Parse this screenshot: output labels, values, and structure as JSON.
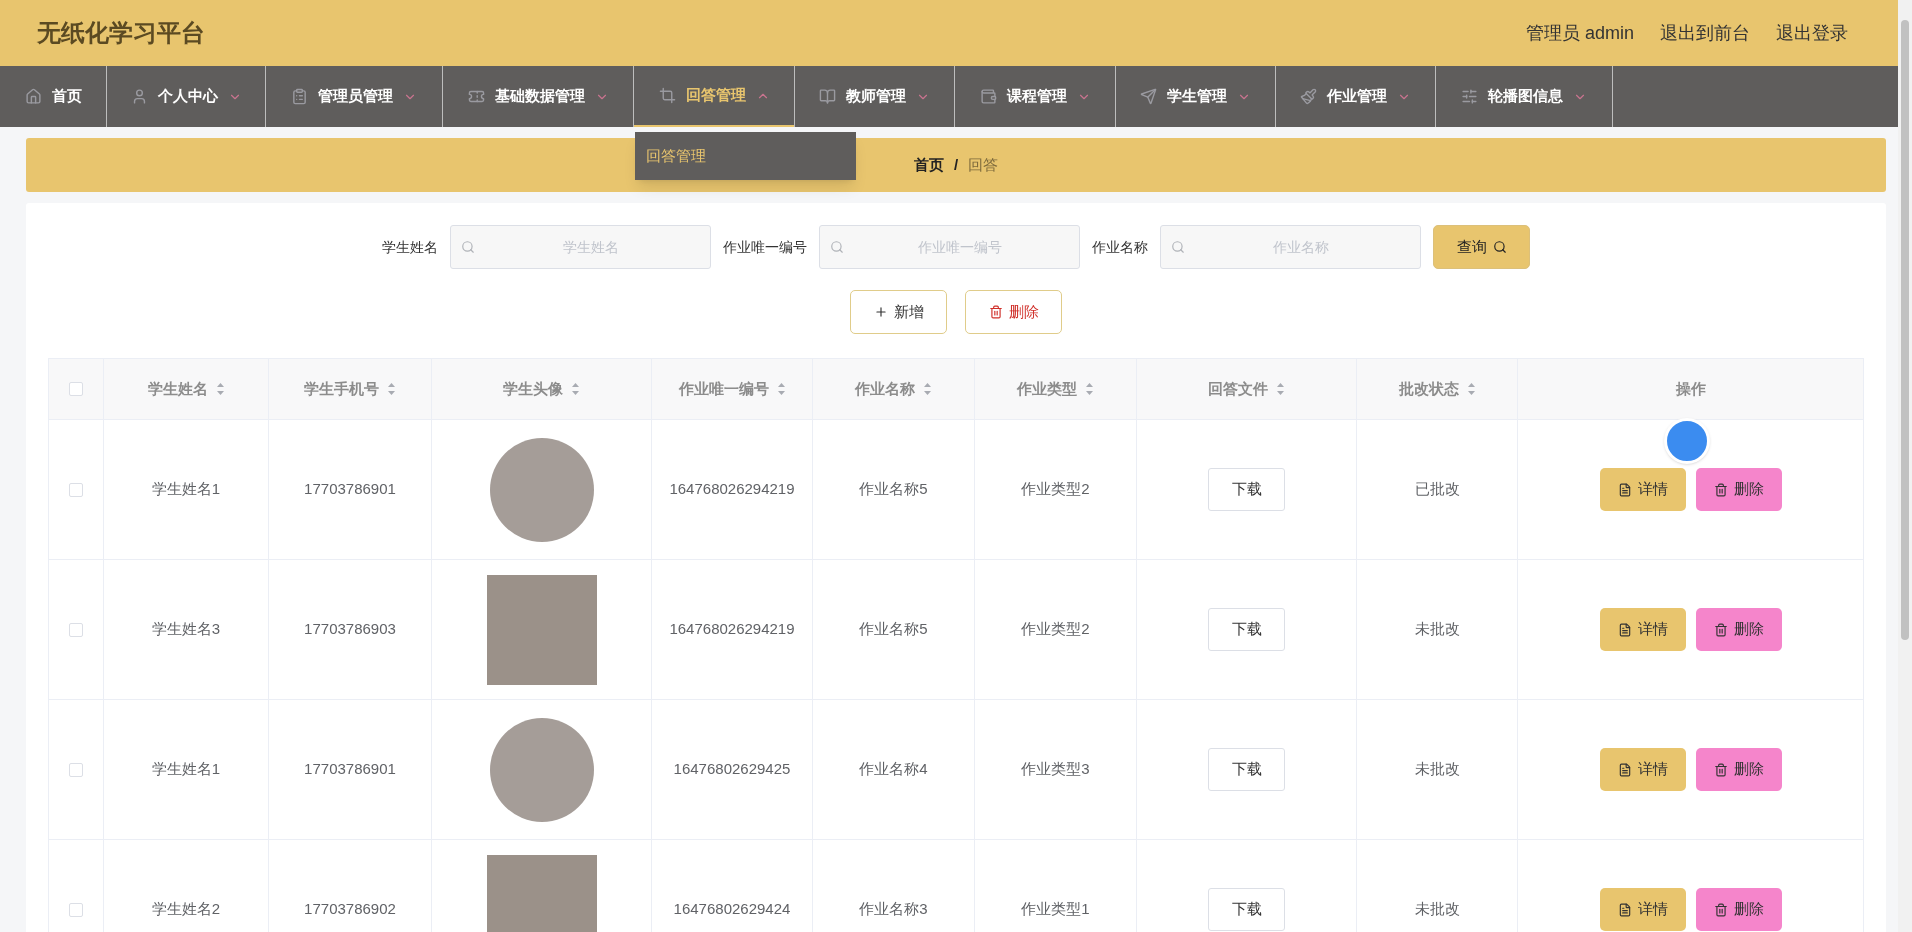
{
  "header": {
    "title": "无纸化学习平台",
    "links": [
      "管理员 admin",
      "退出到前台",
      "退出登录"
    ]
  },
  "nav": [
    {
      "label": "首页",
      "has_caret": false,
      "selected": false
    },
    {
      "label": "个人中心",
      "has_caret": true,
      "selected": false
    },
    {
      "label": "管理员管理",
      "has_caret": true,
      "selected": false
    },
    {
      "label": "基础数据管理",
      "has_caret": true,
      "selected": false
    },
    {
      "label": "回答管理",
      "has_caret": true,
      "selected": true,
      "expanded": true,
      "menu": [
        "回答管理"
      ]
    },
    {
      "label": "教师管理",
      "has_caret": true,
      "selected": false
    },
    {
      "label": "课程管理",
      "has_caret": true,
      "selected": false
    },
    {
      "label": "学生管理",
      "has_caret": true,
      "selected": false
    },
    {
      "label": "作业管理",
      "has_caret": true,
      "selected": false
    },
    {
      "label": "轮播图信息",
      "has_caret": true,
      "selected": false
    }
  ],
  "breadcrumb": {
    "items": [
      "首页",
      "回答"
    ],
    "separator": "/"
  },
  "search": {
    "fields": [
      {
        "label": "学生姓名",
        "placeholder": "学生姓名"
      },
      {
        "label": "作业唯一编号",
        "placeholder": "作业唯一编号"
      },
      {
        "label": "作业名称",
        "placeholder": "作业名称"
      }
    ],
    "button": "查询"
  },
  "actions": [
    {
      "kind": "add",
      "label": "新增"
    },
    {
      "kind": "delete",
      "label": "删除"
    }
  ],
  "table": {
    "all_checked": false,
    "columns": [
      {
        "label": "学生姓名",
        "sortable": true
      },
      {
        "label": "学生手机号",
        "sortable": true
      },
      {
        "label": "学生头像",
        "sortable": true
      },
      {
        "label": "作业唯一编号",
        "sortable": true
      },
      {
        "label": "作业名称",
        "sortable": true
      },
      {
        "label": "作业类型",
        "sortable": true
      },
      {
        "label": "回答文件",
        "sortable": true
      },
      {
        "label": "批改状态",
        "sortable": true
      },
      {
        "label": "操作",
        "sortable": false
      }
    ],
    "rows": [
      {
        "checked": false,
        "name": "学生姓名1",
        "phone": "17703786901",
        "code": "164768026294219",
        "homework": "作业名称5",
        "type": "作业类型2",
        "file": "下载",
        "status": "已批改",
        "buttons": [
          "详情",
          "删除"
        ]
      },
      {
        "checked": false,
        "name": "学生姓名3",
        "phone": "17703786903",
        "code": "164768026294219",
        "homework": "作业名称5",
        "type": "作业类型2",
        "file": "下载",
        "status": "未批改",
        "buttons": [
          "详情",
          "删除"
        ]
      },
      {
        "checked": false,
        "name": "学生姓名1",
        "phone": "17703786901",
        "code": "16476802629425",
        "homework": "作业名称4",
        "type": "作业类型3",
        "file": "下载",
        "status": "未批改",
        "buttons": [
          "详情",
          "删除"
        ]
      },
      {
        "checked": false,
        "name": "学生姓名2",
        "phone": "17703786902",
        "code": "16476802629424",
        "homework": "作业名称3",
        "type": "作业类型1",
        "file": "下载",
        "status": "未批改",
        "buttons": [
          "详情",
          "删除"
        ]
      }
    ]
  }
}
